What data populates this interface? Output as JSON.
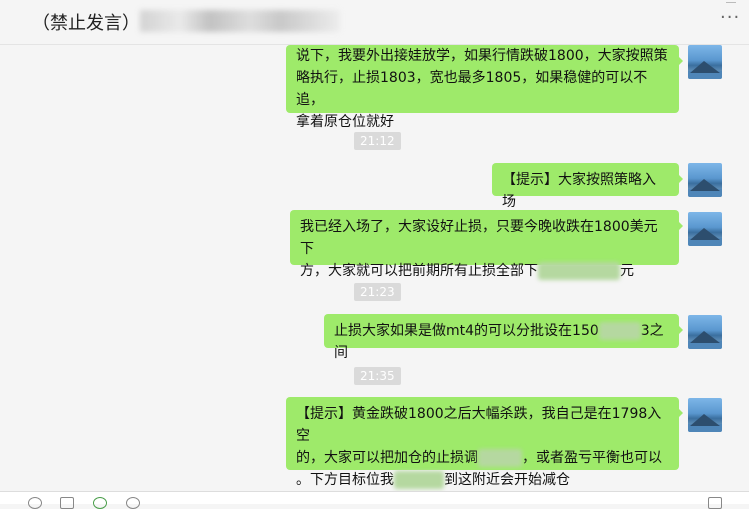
{
  "header": {
    "title": "（禁止发言）",
    "more_icon": "···"
  },
  "messages": [
    {
      "type": "text",
      "lines": [
        "说下，我要外出接娃放学，如果行情跌破1800，大家按照策",
        "略执行，止损1803，宽也最多1805，如果稳健的可以不追，",
        "拿着原仓位就好"
      ]
    },
    {
      "type": "time",
      "text": "21:12"
    },
    {
      "type": "text",
      "lines": [
        "【提示】大家按照策略入场"
      ]
    },
    {
      "type": "text",
      "lines": [
        "我已经入场了，大家设好止损，只要今晚收跌在1800美元下",
        "方，大家就可以把前期所有止损全部下"
      ],
      "tail": "元"
    },
    {
      "type": "time",
      "text": "21:23"
    },
    {
      "type": "text",
      "lines": [
        "止损大家如果是做mt4的可以分批设在150"
      ],
      "tail": "3之间"
    },
    {
      "type": "time",
      "text": "21:35"
    },
    {
      "type": "text",
      "lines": [
        "【提示】黄金跌破1800之后大幅杀跌，我自己是在1798入空",
        "的，大家可以把加仓的止损调"
      ],
      "line2_tail": "，或者盈亏平衡也可以",
      "line3_head": "。下方目标位我",
      "line3_tail": "到这附近会开始减仓"
    }
  ],
  "colors": {
    "bubble": "#9eea6a",
    "background": "#f5f5f5",
    "time_chip": "#dadada"
  }
}
